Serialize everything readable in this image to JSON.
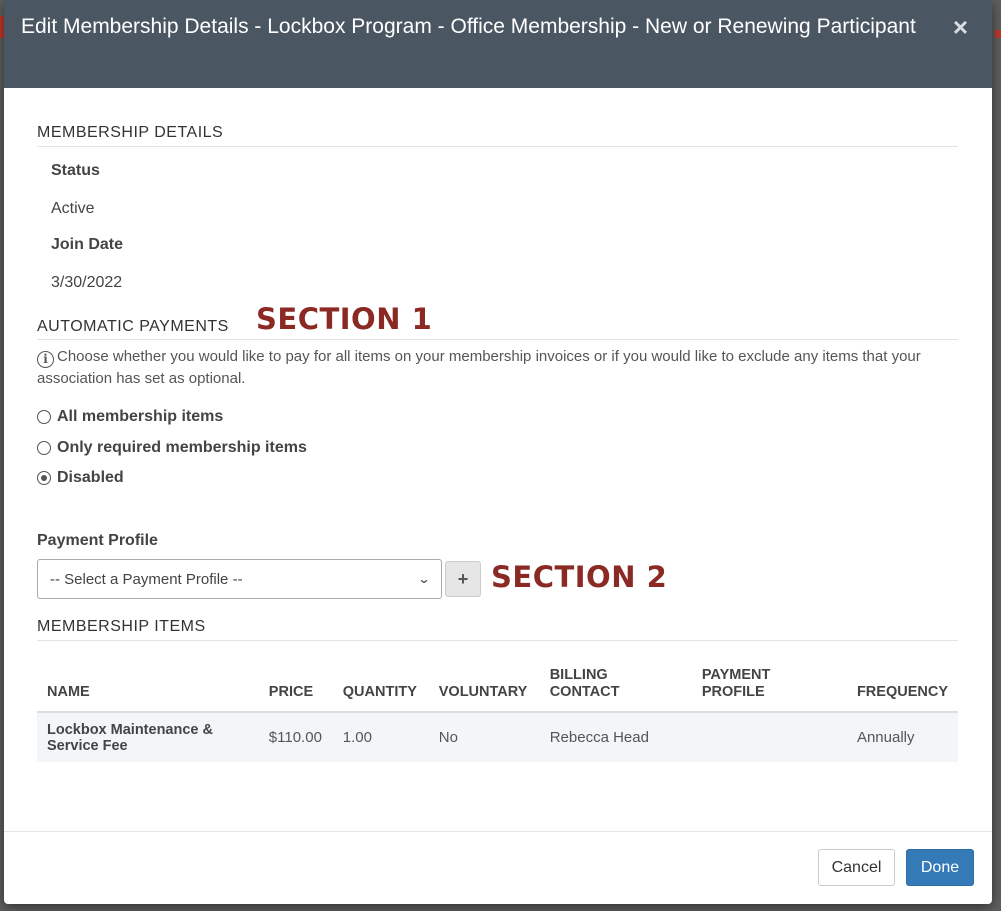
{
  "modal": {
    "title": "Edit Membership Details - Lockbox Program - Office Membership - New or Renewing Participant",
    "close_symbol": "×"
  },
  "membership_details": {
    "heading": "MEMBERSHIP DETAILS",
    "status_label": "Status",
    "status_value": "Active",
    "join_date_label": "Join Date",
    "join_date_value": "3/30/2022"
  },
  "automatic_payments": {
    "heading": "AUTOMATIC PAYMENTS",
    "annotation": "SECTION 1",
    "info_text": "Choose whether you would like to pay for all items on your membership invoices or if you would like to exclude any items that your association has set as optional.",
    "options": [
      {
        "label": "All membership items",
        "checked": false
      },
      {
        "label": "Only required membership items",
        "checked": false
      },
      {
        "label": "Disabled",
        "checked": true
      }
    ]
  },
  "payment_profile": {
    "label": "Payment Profile",
    "selected": "-- Select a Payment Profile --",
    "add_symbol": "+",
    "annotation": "SECTION 2"
  },
  "membership_items": {
    "heading": "MEMBERSHIP ITEMS",
    "columns": [
      "NAME",
      "PRICE",
      "QUANTITY",
      "VOLUNTARY",
      "BILLING CONTACT",
      "PAYMENT PROFILE",
      "FREQUENCY"
    ],
    "rows": [
      {
        "name": "Lockbox Maintenance & Service Fee",
        "price": "$110.00",
        "quantity": "1.00",
        "voluntary": "No",
        "billing_contact": "Rebecca Head",
        "payment_profile": "",
        "frequency": "Annually"
      }
    ]
  },
  "footer": {
    "cancel_label": "Cancel",
    "done_label": "Done"
  },
  "colors": {
    "header_bg": "#4b5663",
    "annotation": "#8b2a24",
    "primary_button": "#337ab7"
  }
}
